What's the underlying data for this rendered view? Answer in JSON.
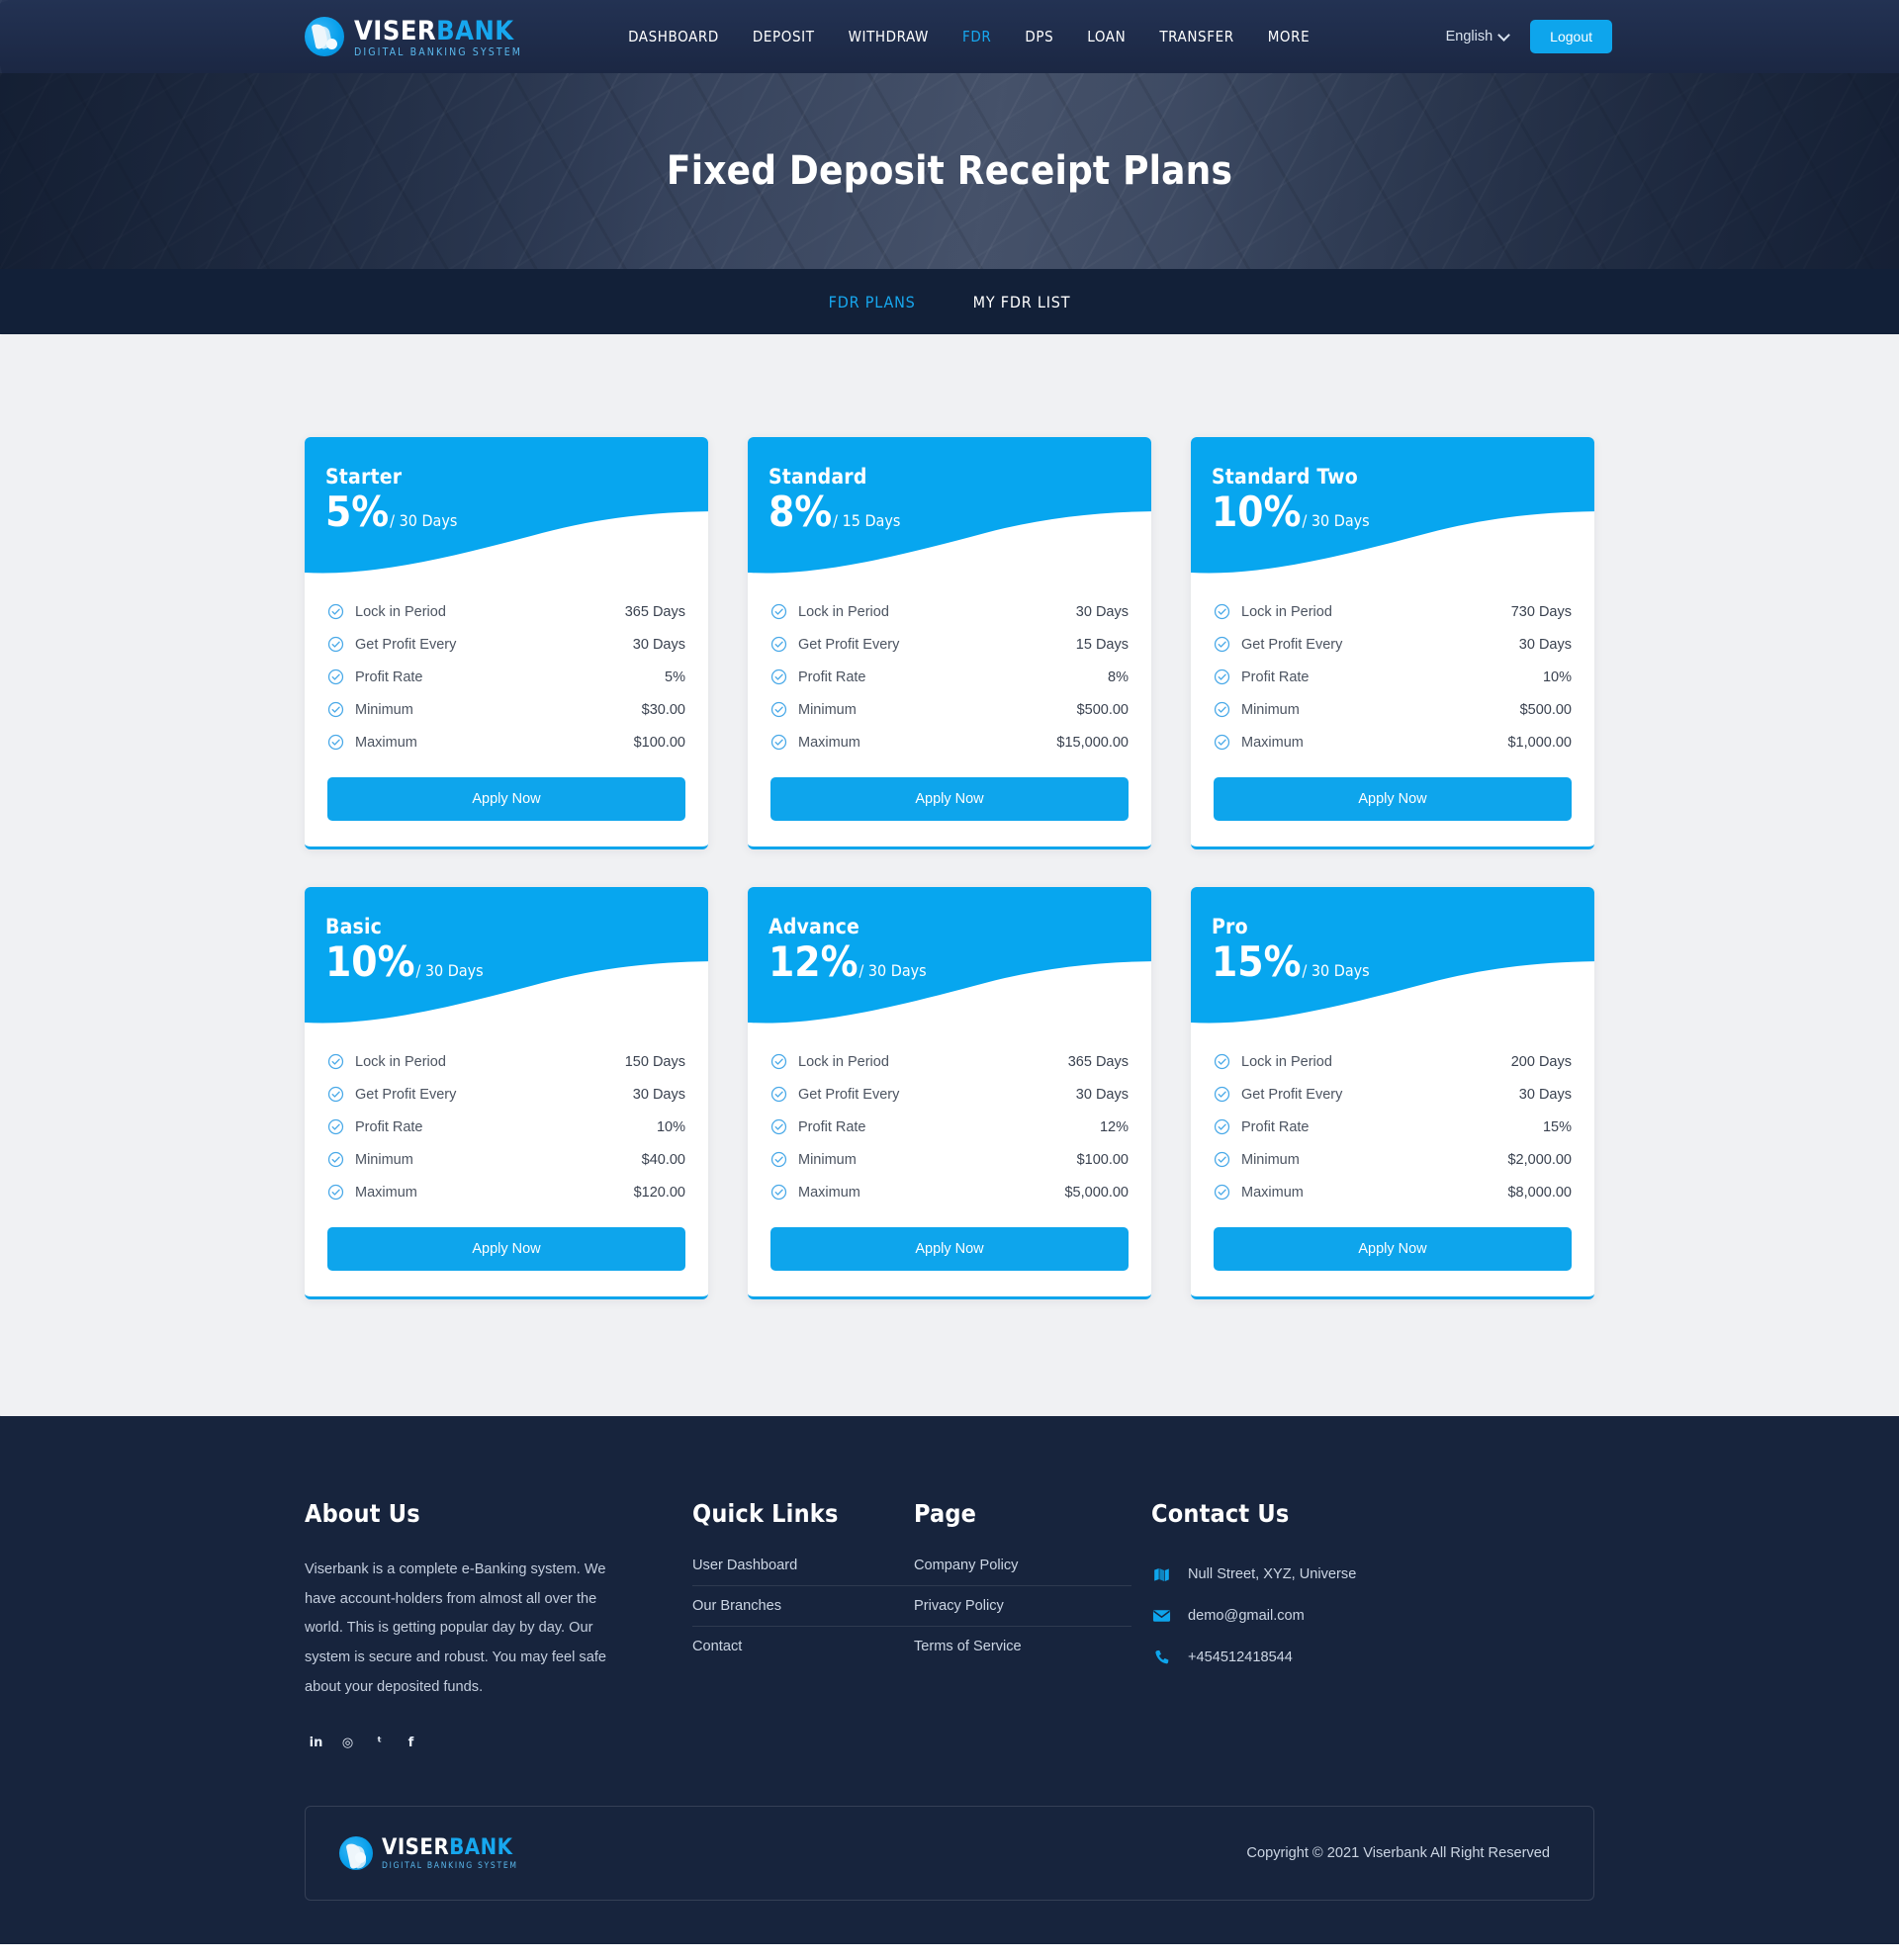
{
  "header": {
    "brand": {
      "part1": "VISER",
      "part2": "BANK",
      "tagline": "DIGITAL BANKING SYSTEM"
    },
    "nav": [
      {
        "label": "DASHBOARD",
        "active": false
      },
      {
        "label": "DEPOSIT",
        "active": false
      },
      {
        "label": "WITHDRAW",
        "active": false
      },
      {
        "label": "FDR",
        "active": true
      },
      {
        "label": "DPS",
        "active": false
      },
      {
        "label": "LOAN",
        "active": false
      },
      {
        "label": "TRANSFER",
        "active": false
      },
      {
        "label": "MORE",
        "active": false
      }
    ],
    "language": "English",
    "logout_label": "Logout"
  },
  "hero": {
    "title": "Fixed Deposit Receipt Plans"
  },
  "tabs": [
    {
      "label": "FDR PLANS",
      "active": true
    },
    {
      "label": "MY FDR LIST",
      "active": false
    }
  ],
  "plans": [
    {
      "name": "Starter",
      "rate": "5%",
      "period": "/ 30 Days",
      "features": [
        {
          "label": "Lock in Period",
          "value": "365 Days"
        },
        {
          "label": "Get Profit Every",
          "value": "30 Days"
        },
        {
          "label": "Profit Rate",
          "value": "5%"
        },
        {
          "label": "Minimum",
          "value": "$30.00"
        },
        {
          "label": "Maximum",
          "value": "$100.00"
        }
      ],
      "apply_label": "Apply Now"
    },
    {
      "name": "Standard",
      "rate": "8%",
      "period": "/ 15 Days",
      "features": [
        {
          "label": "Lock in Period",
          "value": "30 Days"
        },
        {
          "label": "Get Profit Every",
          "value": "15 Days"
        },
        {
          "label": "Profit Rate",
          "value": "8%"
        },
        {
          "label": "Minimum",
          "value": "$500.00"
        },
        {
          "label": "Maximum",
          "value": "$15,000.00"
        }
      ],
      "apply_label": "Apply Now"
    },
    {
      "name": "Standard Two",
      "rate": "10%",
      "period": "/ 30 Days",
      "features": [
        {
          "label": "Lock in Period",
          "value": "730 Days"
        },
        {
          "label": "Get Profit Every",
          "value": "30 Days"
        },
        {
          "label": "Profit Rate",
          "value": "10%"
        },
        {
          "label": "Minimum",
          "value": "$500.00"
        },
        {
          "label": "Maximum",
          "value": "$1,000.00"
        }
      ],
      "apply_label": "Apply Now"
    },
    {
      "name": "Basic",
      "rate": "10%",
      "period": "/ 30 Days",
      "features": [
        {
          "label": "Lock in Period",
          "value": "150 Days"
        },
        {
          "label": "Get Profit Every",
          "value": "30 Days"
        },
        {
          "label": "Profit Rate",
          "value": "10%"
        },
        {
          "label": "Minimum",
          "value": "$40.00"
        },
        {
          "label": "Maximum",
          "value": "$120.00"
        }
      ],
      "apply_label": "Apply Now"
    },
    {
      "name": "Advance",
      "rate": "12%",
      "period": "/ 30 Days",
      "features": [
        {
          "label": "Lock in Period",
          "value": "365 Days"
        },
        {
          "label": "Get Profit Every",
          "value": "30 Days"
        },
        {
          "label": "Profit Rate",
          "value": "12%"
        },
        {
          "label": "Minimum",
          "value": "$100.00"
        },
        {
          "label": "Maximum",
          "value": "$5,000.00"
        }
      ],
      "apply_label": "Apply Now"
    },
    {
      "name": "Pro",
      "rate": "15%",
      "period": "/ 30 Days",
      "features": [
        {
          "label": "Lock in Period",
          "value": "200 Days"
        },
        {
          "label": "Get Profit Every",
          "value": "30 Days"
        },
        {
          "label": "Profit Rate",
          "value": "15%"
        },
        {
          "label": "Minimum",
          "value": "$2,000.00"
        },
        {
          "label": "Maximum",
          "value": "$8,000.00"
        }
      ],
      "apply_label": "Apply Now"
    }
  ],
  "footer": {
    "about": {
      "title": "About Us",
      "text": "Viserbank is a complete e-Banking system. We have account-holders from almost all over the world. This is getting popular day by day. Our system is secure and robust. You may feel safe about your deposited funds.",
      "socials": [
        {
          "name": "linkedin-icon",
          "glyph": "in"
        },
        {
          "name": "instagram-icon",
          "glyph": "◎"
        },
        {
          "name": "twitter-icon",
          "glyph": "ᵗ"
        },
        {
          "name": "facebook-icon",
          "glyph": "f"
        }
      ]
    },
    "quick_links": {
      "title": "Quick Links",
      "items": [
        "User Dashboard",
        "Our Branches",
        "Contact"
      ]
    },
    "page": {
      "title": "Page",
      "items": [
        "Company Policy",
        "Privacy Policy",
        "Terms of Service"
      ]
    },
    "contact": {
      "title": "Contact Us",
      "items": [
        {
          "icon": "map-icon",
          "value": "Null Street, XYZ, Universe"
        },
        {
          "icon": "envelope-icon",
          "value": "demo@gmail.com"
        },
        {
          "icon": "phone-icon",
          "value": "+454512418544"
        }
      ]
    },
    "copyright": "Copyright © 2021 Viserbank All Right Reserved"
  },
  "colors": {
    "accent": "#0ea5ec",
    "dark": "#17243d",
    "header": "#1d2b48",
    "tabbar": "#122038"
  }
}
